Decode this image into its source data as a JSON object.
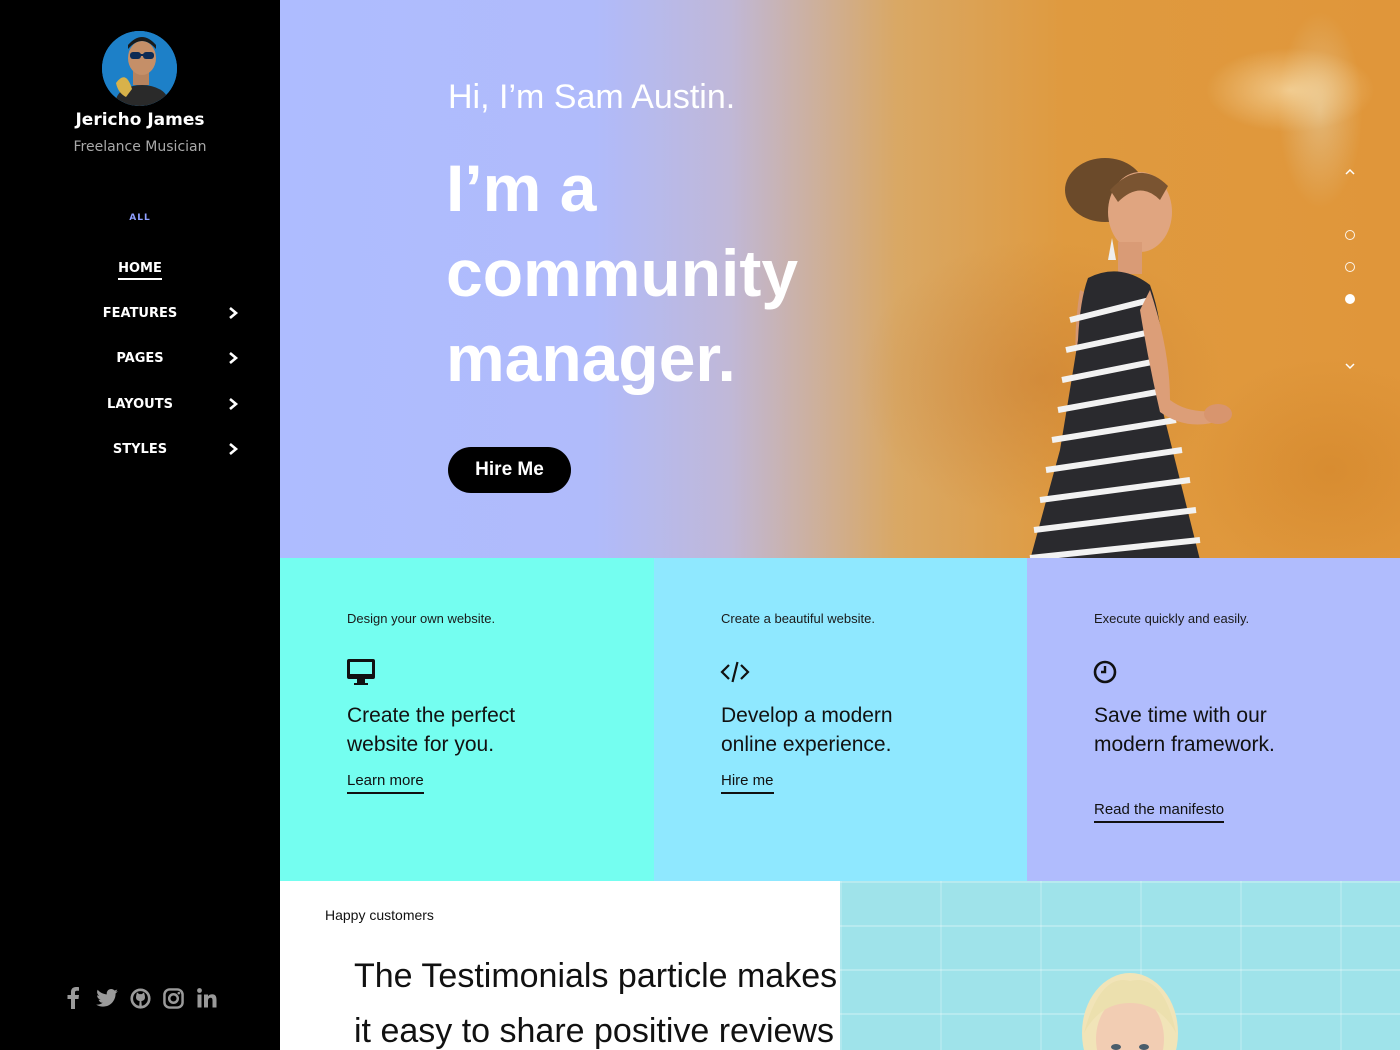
{
  "profile": {
    "name": "Jericho James",
    "role": "Freelance Musician"
  },
  "nav": {
    "filter": "ALL",
    "items": [
      {
        "label": "HOME",
        "active": true,
        "has_submenu": false
      },
      {
        "label": "FEATURES",
        "active": false,
        "has_submenu": true
      },
      {
        "label": "PAGES",
        "active": false,
        "has_submenu": true
      },
      {
        "label": "LAYOUTS",
        "active": false,
        "has_submenu": true
      },
      {
        "label": "STYLES",
        "active": false,
        "has_submenu": true
      }
    ]
  },
  "social": [
    "facebook-icon",
    "twitter-icon",
    "github-icon",
    "instagram-icon",
    "linkedin-icon"
  ],
  "hero": {
    "greeting": "Hi, I’m Sam Austin.",
    "title_line1": "I’m a",
    "title_line2": "community",
    "title_line3": "manager.",
    "cta": "Hire Me",
    "slide_count": 3,
    "active_slide": 3
  },
  "cards": [
    {
      "kicker": "Design your own website.",
      "icon": "monitor-icon",
      "heading": "Create the perfect website for you.",
      "link": "Learn more",
      "color": "#74fef0"
    },
    {
      "kicker": "Create a beautiful website.",
      "icon": "code-icon",
      "heading": "Develop a modern online experience.",
      "link": "Hire me",
      "color": "#8fe8ff"
    },
    {
      "kicker": "Execute quickly and easily.",
      "icon": "clock-icon",
      "heading": "Save time with our modern framework.",
      "link": "Read the manifesto",
      "color": "#b0bcfd"
    }
  ],
  "testimonials": {
    "kicker": "Happy customers",
    "line1": "The Testimonials particle makes",
    "line2": "it easy to share positive reviews"
  },
  "colors": {
    "sidebar_bg": "#000000",
    "accent": "#8fa0ff",
    "hero_start": "#aebcff",
    "hero_end": "#e0963a"
  }
}
